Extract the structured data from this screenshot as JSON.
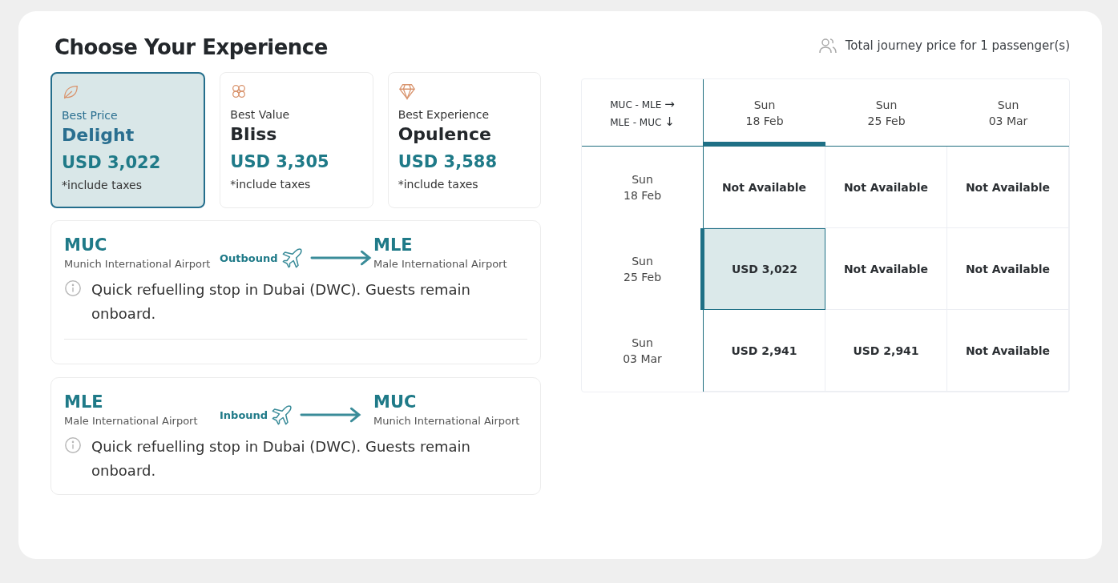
{
  "title": "Choose Your Experience",
  "passenger_note": "Total journey price for 1 passenger(s)",
  "experiences": [
    {
      "kind": "leaf",
      "tag": "Best Price",
      "name": "Delight",
      "price": "USD 3,022",
      "note": "*include taxes",
      "selected": true
    },
    {
      "kind": "flower",
      "tag": "Best Value",
      "name": "Bliss",
      "price": "USD 3,305",
      "note": "*include taxes",
      "selected": false
    },
    {
      "kind": "diamond",
      "tag": "Best Experience",
      "name": "Opulence",
      "price": "USD 3,588",
      "note": "*include taxes",
      "selected": false
    }
  ],
  "flights": [
    {
      "from_code": "MUC",
      "from_airport": "Munich International Airport",
      "direction": "Outbound",
      "to_code": "MLE",
      "to_airport": "Male International Airport",
      "notice": "Quick refuelling stop in Dubai (DWC). Guests remain onboard.",
      "divider": true
    },
    {
      "from_code": "MLE",
      "from_airport": "Male International Airport",
      "direction": "Inbound",
      "to_code": "MUC",
      "to_airport": "Munich International Airport",
      "notice": "Quick refuelling stop in Dubai (DWC). Guests remain onboard.",
      "divider": false
    }
  ],
  "grid": {
    "routes": [
      {
        "text": "MUC - MLE",
        "arrow": "→"
      },
      {
        "text": "MLE - MUC",
        "arrow": "↓"
      }
    ],
    "columns": [
      {
        "day": "Sun",
        "date": "18 Feb",
        "selected": true
      },
      {
        "day": "Sun",
        "date": "25 Feb",
        "selected": false
      },
      {
        "day": "Sun",
        "date": "03 Mar",
        "selected": false
      }
    ],
    "rows": [
      {
        "day": "Sun",
        "date": "18 Feb",
        "cells": [
          {
            "text": "Not Available",
            "selected": false
          },
          {
            "text": "Not Available",
            "selected": false
          },
          {
            "text": "Not Available",
            "selected": false
          }
        ]
      },
      {
        "day": "Sun",
        "date": "25 Feb",
        "cells": [
          {
            "text": "USD 3,022",
            "selected": true
          },
          {
            "text": "Not Available",
            "selected": false
          },
          {
            "text": "Not Available",
            "selected": false
          }
        ]
      },
      {
        "day": "Sun",
        "date": "03 Mar",
        "cells": [
          {
            "text": "USD 2,941",
            "selected": false
          },
          {
            "text": "USD 2,941",
            "selected": false
          },
          {
            "text": "Not Available",
            "selected": false
          }
        ]
      }
    ]
  }
}
